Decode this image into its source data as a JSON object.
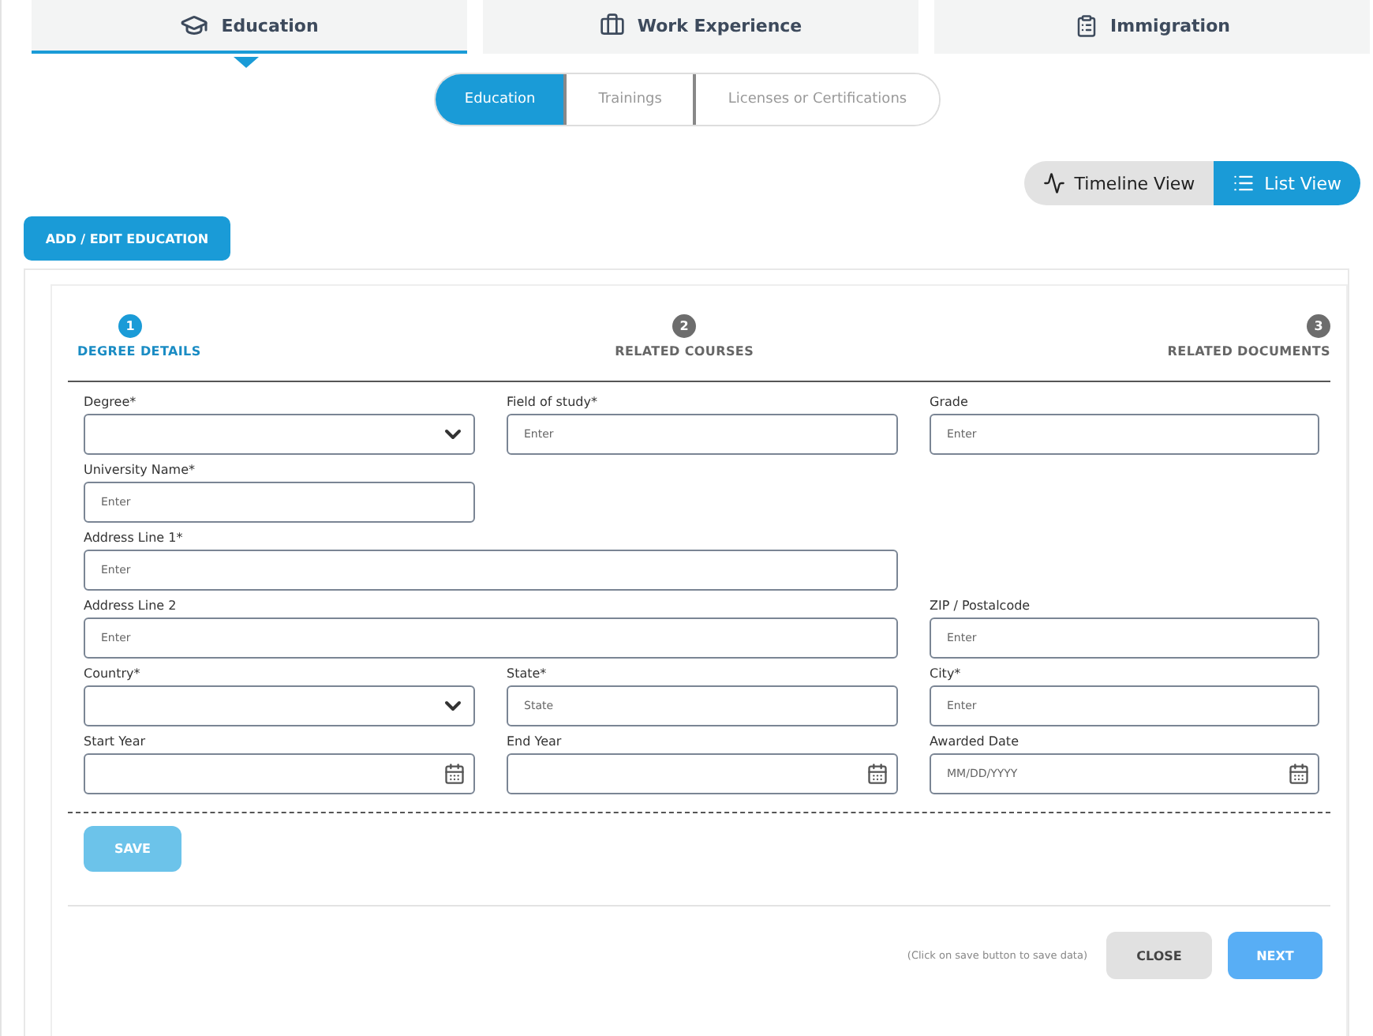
{
  "main_tabs": [
    {
      "label": "Education",
      "selected": true
    },
    {
      "label": "Work Experience",
      "selected": false
    },
    {
      "label": "Immigration",
      "selected": false
    }
  ],
  "sub_tabs": [
    {
      "label": "Education",
      "selected": true
    },
    {
      "label": "Trainings",
      "selected": false
    },
    {
      "label": "Licenses or Certifications",
      "selected": false
    }
  ],
  "view_toggle": [
    {
      "label": "Timeline View",
      "selected": false
    },
    {
      "label": "List View",
      "selected": true
    }
  ],
  "add_button": "ADD / EDIT EDUCATION",
  "stepper": [
    {
      "number": "1",
      "label": "DEGREE DETAILS",
      "selected": true
    },
    {
      "number": "2",
      "label": "RELATED COURSES",
      "selected": false
    },
    {
      "number": "3",
      "label": "RELATED DOCUMENTS",
      "selected": false
    }
  ],
  "form_rows": [
    [
      {
        "label": "Degree*",
        "kind": "select"
      },
      {
        "label": "Field of study*",
        "kind": "text",
        "placeholder": "Enter"
      },
      {
        "label": "Grade",
        "kind": "text",
        "placeholder": "Enter"
      }
    ],
    [
      {
        "label": "University Name*",
        "kind": "text",
        "placeholder": "Enter"
      }
    ],
    [
      {
        "label": "Address Line 1*",
        "kind": "text",
        "placeholder": "Enter",
        "wide": true
      }
    ],
    [
      {
        "label": "Address Line 2",
        "kind": "text",
        "placeholder": "Enter",
        "wide": true
      },
      {
        "label": "ZIP / Postalcode",
        "kind": "text",
        "placeholder": "Enter"
      }
    ],
    [
      {
        "label": "Country*",
        "kind": "select"
      },
      {
        "label": "State*",
        "kind": "text",
        "placeholder": "State"
      },
      {
        "label": "City*",
        "kind": "text",
        "placeholder": "Enter"
      }
    ],
    [
      {
        "label": "Start Year",
        "kind": "date"
      },
      {
        "label": "End Year",
        "kind": "date"
      },
      {
        "label": "Awarded Date",
        "kind": "date",
        "placeholder": "MM/DD/YYYY"
      }
    ]
  ],
  "save_button": {
    "label": "SAVE",
    "disabled": true
  },
  "footer": {
    "hint": "(Click on save button to save data)",
    "buttons": [
      {
        "label": "CLOSE",
        "kind": "secondary"
      },
      {
        "label": "NEXT",
        "kind": "primary"
      }
    ]
  }
}
